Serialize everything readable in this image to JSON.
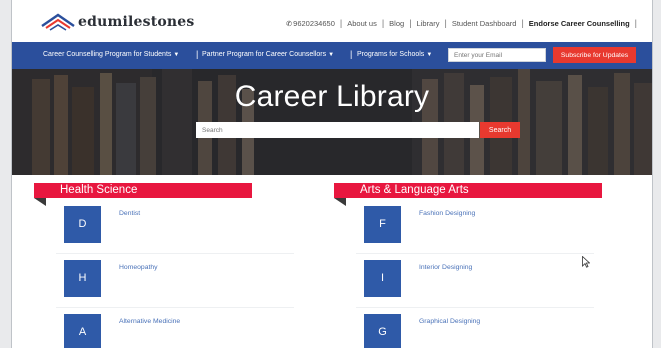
{
  "topbar": {
    "logo_text": "edumilestones",
    "phone": "9620234650",
    "links": [
      "About us",
      "Blog",
      "Library",
      "Student Dashboard"
    ],
    "highlight_link": "Endorse Career Counselling"
  },
  "nav": {
    "items": [
      {
        "label": "Career Counselling Program for Students"
      },
      {
        "label": "Partner Program for Career Counsellors"
      },
      {
        "label": "Programs for Schools"
      }
    ],
    "email_placeholder": "Enter your Email",
    "subscribe_label": "Subscribe for Updates"
  },
  "hero": {
    "title": "Career Library",
    "search_placeholder": "Search",
    "search_button": "Search"
  },
  "columns": [
    {
      "title": "Health Science",
      "cards": [
        {
          "letter": "D",
          "label": "Dentist"
        },
        {
          "letter": "H",
          "label": "Homeopathy"
        },
        {
          "letter": "A",
          "label": "Alternative Medicine"
        }
      ]
    },
    {
      "title": "Arts & Language Arts",
      "cards": [
        {
          "letter": "F",
          "label": "Fashion Designing"
        },
        {
          "letter": "I",
          "label": "Interior Designing"
        },
        {
          "letter": "G",
          "label": "Graphical Designing"
        }
      ]
    }
  ],
  "colors": {
    "nav_bg": "#2b4f9c",
    "accent_red": "#e8392f",
    "ribbon_pink": "#e8173f",
    "tile_blue": "#2f5aa8"
  }
}
